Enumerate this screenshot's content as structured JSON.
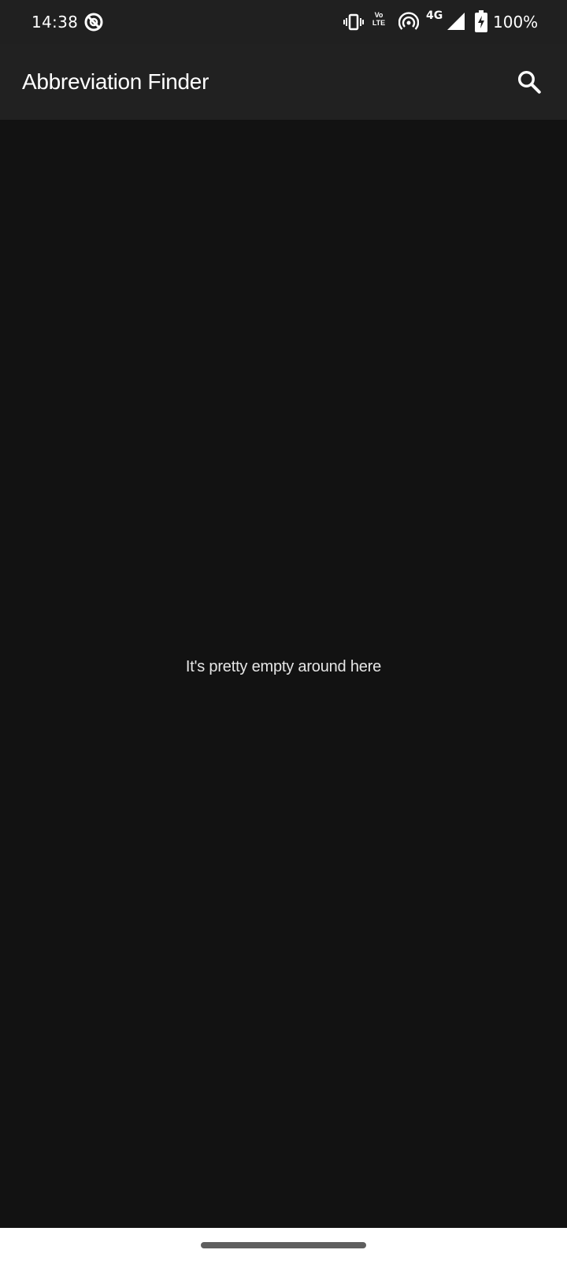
{
  "status_bar": {
    "time": "14:38",
    "volte_top": "Vo",
    "volte_bottom": "LTE",
    "network": "4G",
    "battery": "100%",
    "icons": [
      "app-notification-icon",
      "vibrate-icon",
      "volte-icon",
      "hotspot-icon",
      "signal-icon",
      "battery-charging-icon"
    ]
  },
  "app_bar": {
    "title": "Abbreviation Finder",
    "search_icon": "search-icon"
  },
  "content": {
    "empty_message": "It's pretty empty around here"
  },
  "colors": {
    "background": "#121212",
    "app_bar": "#212121",
    "status_bar": "#202020",
    "text": "#ffffff",
    "nav_bar": "#ffffff",
    "home_indicator": "#5f5f5f"
  }
}
